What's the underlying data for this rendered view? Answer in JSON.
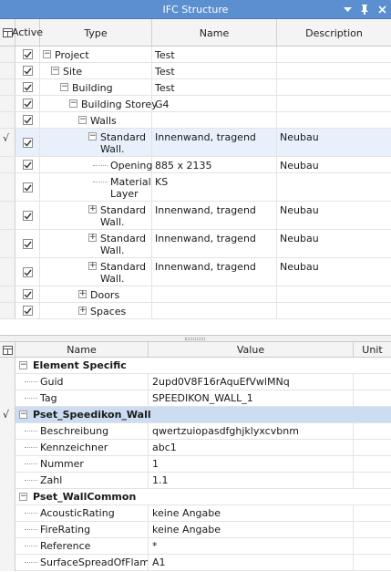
{
  "window": {
    "title": "IFC Structure",
    "colors": {
      "titlebar": "#5b8fd0",
      "selected_row": "#e8f0fb",
      "selected_group": "#cbdcf3"
    }
  },
  "tree": {
    "columns": {
      "active": "Active",
      "type": "Type",
      "name": "Name",
      "description": "Description"
    },
    "rows": [
      {
        "type": "Project",
        "name": "Test",
        "description": "",
        "active": true
      },
      {
        "type": "Site",
        "name": "Test",
        "description": "",
        "active": true
      },
      {
        "type": "Building",
        "name": "Test",
        "description": "",
        "active": true
      },
      {
        "type": "Building Storey",
        "name": "G4",
        "description": "",
        "active": true
      },
      {
        "type": "Walls",
        "name": "",
        "description": "",
        "active": true
      },
      {
        "type_line1": "Standard",
        "type_line2": "Wall.",
        "name": "Innenwand, tragend",
        "description": "Neubau",
        "active": true,
        "selected": true,
        "indicator": "√"
      },
      {
        "type": "Opening",
        "name": "885 x 2135",
        "description": "Neubau",
        "active": true
      },
      {
        "type_line1": "Material",
        "type_line2": "Layer",
        "name": "KS",
        "description": "",
        "active": true
      },
      {
        "type_line1": "Standard",
        "type_line2": "Wall.",
        "name": "Innenwand, tragend",
        "description": "Neubau",
        "active": true
      },
      {
        "type_line1": "Standard",
        "type_line2": "Wall.",
        "name": "Innenwand, tragend",
        "description": "Neubau",
        "active": true
      },
      {
        "type_line1": "Standard",
        "type_line2": "Wall.",
        "name": "Innenwand, tragend",
        "description": "Neubau",
        "active": true
      },
      {
        "type": "Doors",
        "name": "",
        "description": "",
        "active": true
      },
      {
        "type": "Spaces",
        "name": "",
        "description": "",
        "active": true
      }
    ]
  },
  "properties": {
    "columns": {
      "name": "Name",
      "value": "Value",
      "unit": "Unit"
    },
    "groups": [
      {
        "title": "Element Specific",
        "items": [
          {
            "name": "Guid",
            "value": "2upd0V8F16rAquEfVwlMNq"
          },
          {
            "name": "Tag",
            "value": "SPEEDIKON_WALL_1"
          }
        ]
      },
      {
        "title": "Pset_Speedikon_Wall",
        "selected": true,
        "indicator": "√",
        "items": [
          {
            "name": "Beschreibung",
            "value": "qwertzuiopasdfghjklyxcvbnm"
          },
          {
            "name": "Kennzeichner",
            "value": "abc1"
          },
          {
            "name": "Nummer",
            "value": "1"
          },
          {
            "name": "Zahl",
            "value": "1.1"
          }
        ]
      },
      {
        "title": "Pset_WallCommon",
        "items": [
          {
            "name": "AcousticRating",
            "value": "keine Angabe"
          },
          {
            "name": "FireRating",
            "value": "keine Angabe"
          },
          {
            "name": "Reference",
            "value": "*"
          },
          {
            "name": "SurfaceSpreadOfFlame",
            "value": "A1"
          }
        ]
      }
    ]
  }
}
